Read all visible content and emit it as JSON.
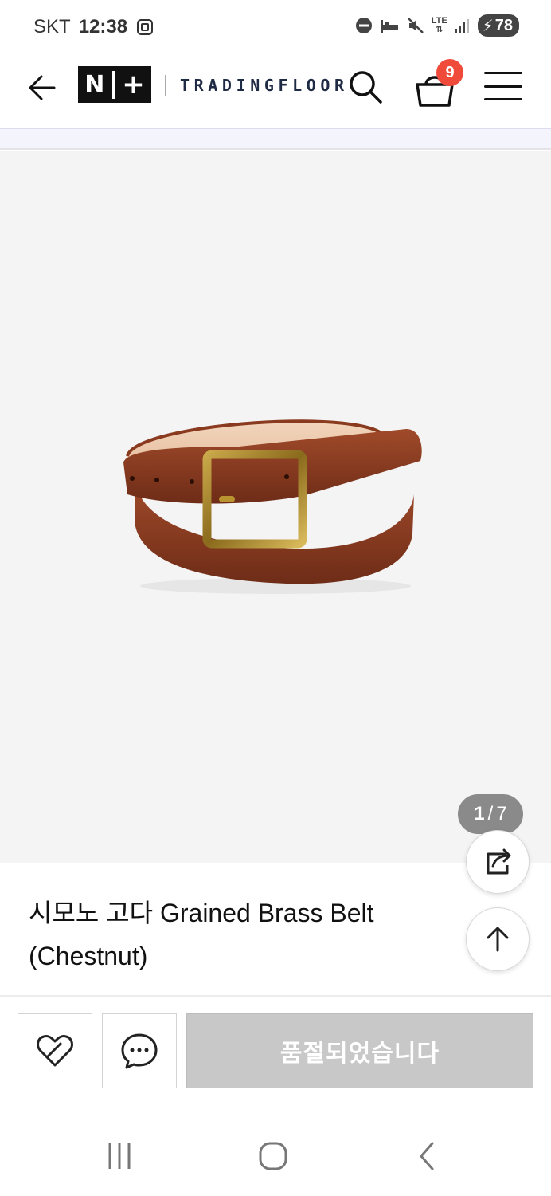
{
  "status_bar": {
    "carrier": "SKT",
    "time": "12:38",
    "network": "LTE",
    "battery": "78"
  },
  "header": {
    "logo_left": "N",
    "logo_right": "+",
    "brand": "TRADINGFLOOR",
    "cart_count": "9"
  },
  "gallery": {
    "current": "1",
    "separator": "/",
    "total": "7"
  },
  "product": {
    "title": "시모노 고다 Grained Brass Belt (Chestnut)"
  },
  "actions": {
    "soldout_label": "품절되었습니다"
  },
  "colors": {
    "accent_badge": "#f04a3b",
    "soldout_bg": "#c8c8c8"
  }
}
